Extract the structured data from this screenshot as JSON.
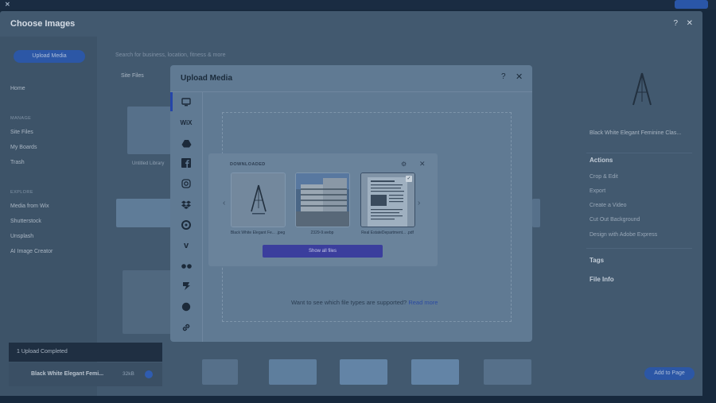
{
  "dialog": {
    "title": "Choose Images",
    "help": "?",
    "close": "✕"
  },
  "left": {
    "upload_button": "Upload Media",
    "home": "Home",
    "manage_label": "MANAGE",
    "manage": [
      "Site Files",
      "My Boards",
      "Trash"
    ],
    "explore_label": "EXPLORE",
    "explore": [
      "Media from Wix",
      "Shutterstock",
      "Unsplash",
      "AI Image Creator"
    ]
  },
  "main": {
    "search_placeholder": "Search for business, location, fitness & more",
    "site_files": "Site Files",
    "tile_caption": "Untitled Library"
  },
  "right": {
    "file_title": "Black White Elegant Feminine Clas...",
    "actions_title": "Actions",
    "actions": [
      "Crop & Edit",
      "Export",
      "Create a Video",
      "Cut Out Background",
      "Design with Adobe Express"
    ],
    "tags": "Tags",
    "file_info": "File Info",
    "add_button": "Add to Page"
  },
  "toast": {
    "title": "1 Upload Completed",
    "file_name": "Black White Elegant Femi...",
    "file_size": "32kB"
  },
  "modal": {
    "title": "Upload Media",
    "help": "?",
    "close": "✕",
    "sources": [
      "my-computer",
      "wix",
      "google-drive",
      "facebook",
      "instagram",
      "dropbox",
      "box",
      "vimeo",
      "flickr",
      "deviantart",
      "web",
      "link"
    ],
    "hint_prefix": "Want to see which file types are supported?",
    "hint_link": "Read more"
  },
  "popover": {
    "title": "DOWNLOADED",
    "files": [
      {
        "name": "Black White Elegant Fe... .jpeg",
        "selected": false
      },
      {
        "name": "2329-9.webp",
        "selected": false
      },
      {
        "name": "Real EstateDepartment... .pdf",
        "selected": true
      }
    ],
    "show_all": "Show all files"
  },
  "colors": {
    "accent": "#2545a8",
    "show_all": "#3b3e9d",
    "overlay": "#17293d"
  }
}
